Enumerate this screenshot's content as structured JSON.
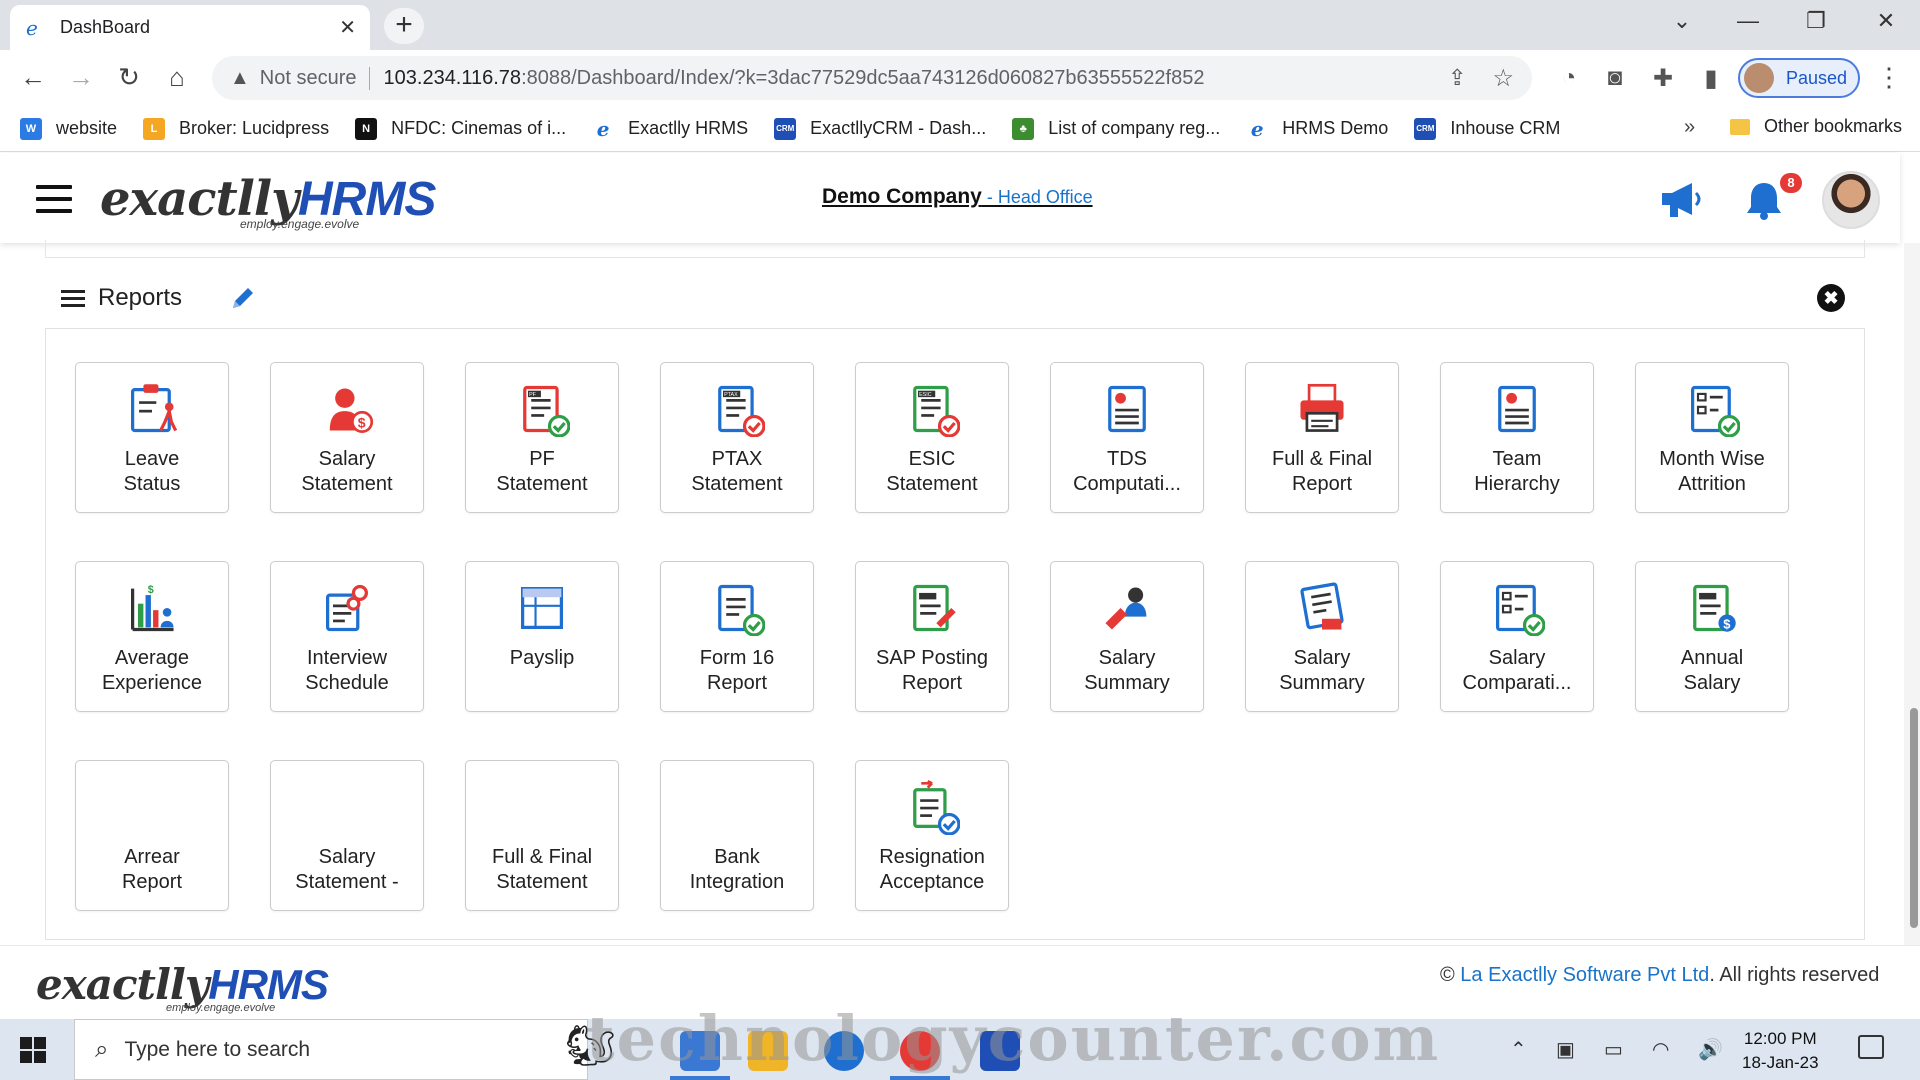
{
  "browser": {
    "tab_title": "DashBoard",
    "new_tab": "+",
    "not_secure": "Not secure",
    "url_host": "103.234.116.78",
    "url_path": ":8088/Dashboard/Index/?k=3dac77529dc5aa743126d060827b63555522f852",
    "profile_label": "Paused",
    "bookmarks": [
      {
        "label": "website",
        "icon": "w-icon",
        "color": "#2c7be5"
      },
      {
        "label": "Broker: Lucidpress",
        "icon": "lucidpress-icon",
        "color": "#f5a623"
      },
      {
        "label": "NFDC: Cinemas of i...",
        "icon": "nfdc-icon",
        "color": "#111111"
      },
      {
        "label": "Exactlly HRMS",
        "icon": "ie-icon",
        "color": "#1f6fd1"
      },
      {
        "label": "ExactllyCRM - Dash...",
        "icon": "crm-icon",
        "color": "#1f4fb4"
      },
      {
        "label": "List of company reg...",
        "icon": "tree-icon",
        "color": "#3c8d2f"
      },
      {
        "label": "HRMS Demo",
        "icon": "ie-icon",
        "color": "#1f6fd1"
      },
      {
        "label": "Inhouse CRM",
        "icon": "crm-icon",
        "color": "#1f4fb4"
      }
    ],
    "bookmarks_more": "»",
    "other_bookmarks": "Other bookmarks"
  },
  "header": {
    "logo_main": "exactlly",
    "logo_hr": "HRMS",
    "logo_tagline": "employ.engage.evolve",
    "company_name": "Demo Company",
    "office": " - Head Office",
    "notification_count": "8"
  },
  "reports": {
    "title": "Reports",
    "close": "✖",
    "tiles": [
      {
        "label": "Leave\nStatus",
        "icon": "leave-status-icon"
      },
      {
        "label": "Salary\nStatement",
        "icon": "salary-statement-icon"
      },
      {
        "label": "PF\nStatement",
        "icon": "pf-statement-icon",
        "badge": "PF"
      },
      {
        "label": "PTAX\nStatement",
        "icon": "ptax-statement-icon",
        "badge": "PTAX"
      },
      {
        "label": "ESIC\nStatement",
        "icon": "esic-statement-icon",
        "badge": "ESIC"
      },
      {
        "label": "TDS\nComputati...",
        "icon": "tds-computation-icon"
      },
      {
        "label": "Full & Final\nReport",
        "icon": "printer-icon"
      },
      {
        "label": "Team\nHierarchy",
        "icon": "team-hierarchy-icon"
      },
      {
        "label": "Month Wise\nAttrition",
        "icon": "checklist-icon"
      },
      {
        "label": "Average\nExperience",
        "icon": "average-experience-icon"
      },
      {
        "label": "Interview\nSchedule",
        "icon": "interview-schedule-icon"
      },
      {
        "label": "Payslip",
        "icon": "payslip-icon"
      },
      {
        "label": "Form 16\nReport",
        "icon": "form16-icon"
      },
      {
        "label": "SAP Posting\nReport",
        "icon": "sap-posting-icon"
      },
      {
        "label": "Salary\nSummary",
        "icon": "salary-summary-person-icon"
      },
      {
        "label": "Salary\nSummary",
        "icon": "salary-summary-doc-icon"
      },
      {
        "label": "Salary\nComparati...",
        "icon": "salary-comparison-icon"
      },
      {
        "label": "Annual\nSalary",
        "icon": "annual-salary-icon"
      },
      {
        "label": "Arrear\nReport",
        "icon": ""
      },
      {
        "label": "Salary\nStatement -",
        "icon": ""
      },
      {
        "label": "Full & Final\nStatement",
        "icon": ""
      },
      {
        "label": "Bank\nIntegration",
        "icon": ""
      },
      {
        "label": "Resignation\nAcceptance",
        "icon": "resignation-acceptance-icon"
      }
    ]
  },
  "footer": {
    "copyright_symbol": "© ",
    "company_link": "La Exactlly Software Pvt Ltd",
    "rights": ". All rights reserved"
  },
  "taskbar": {
    "search_placeholder": "Type here to search",
    "time": "12:00 PM",
    "date": "18-Jan-23",
    "watermark": "technologycounter.com"
  },
  "colors": {
    "brand_blue": "#1f4fb4",
    "link_blue": "#1a73c9",
    "icon_blue": "#1f6fd1",
    "icon_red": "#e53935",
    "icon_green": "#2e9e48",
    "badge_red": "#e53935"
  }
}
